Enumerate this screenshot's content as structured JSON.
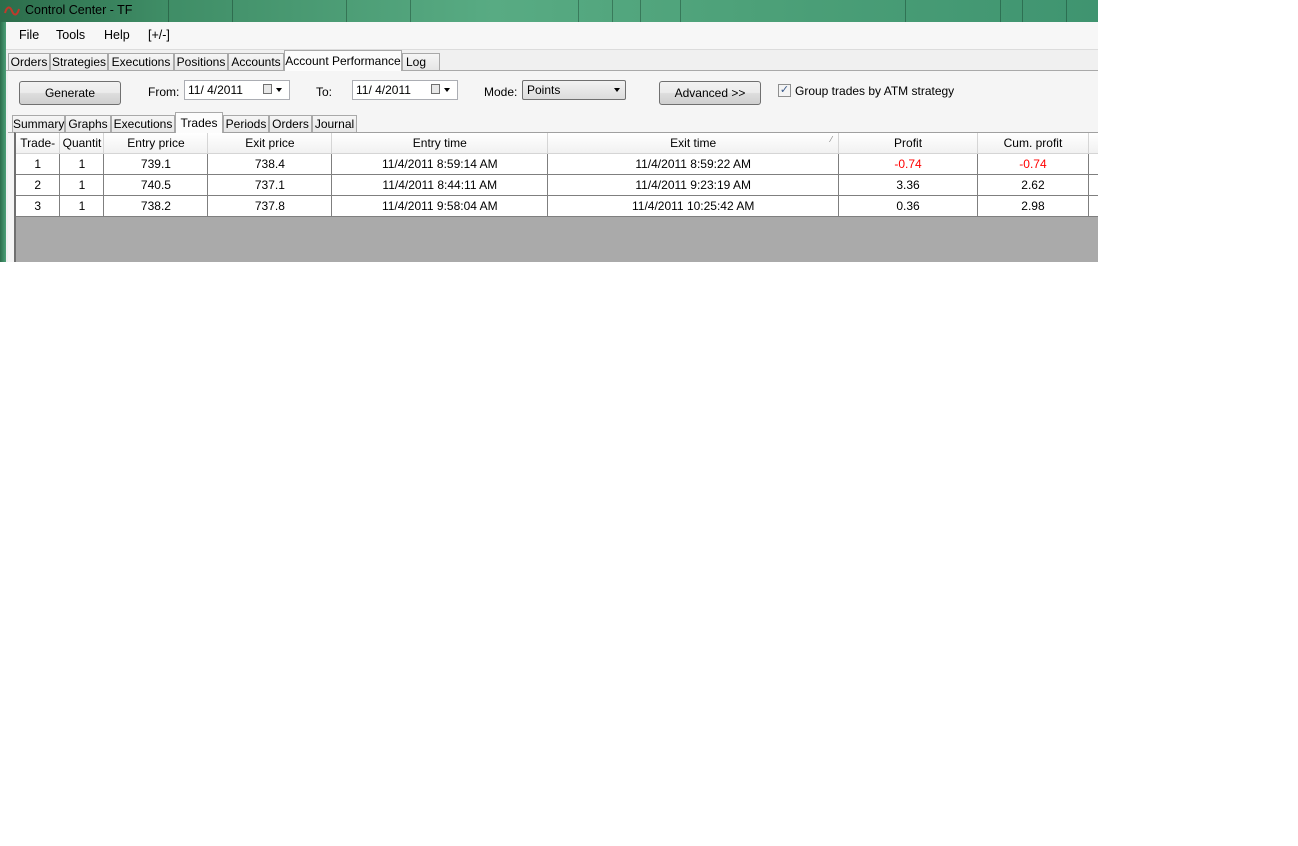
{
  "window": {
    "title": "Control Center - TF"
  },
  "menu": {
    "items": [
      "File",
      "Tools",
      "Help",
      "[+/-]"
    ]
  },
  "main_tabs": [
    "Orders",
    "Strategies",
    "Executions",
    "Positions",
    "Accounts",
    "Account Performance",
    "Log"
  ],
  "main_tab_active": "Account Performance",
  "toolbar": {
    "generate_label": "Generate",
    "from_label": "From:",
    "from_value": "11/ 4/2011",
    "to_label": "To:",
    "to_value": "11/ 4/2011",
    "mode_label": "Mode:",
    "mode_value": "Points",
    "advanced_label": "Advanced >>",
    "group_checkbox_label": "Group trades by ATM strategy",
    "group_checkbox_checked": true
  },
  "sub_tabs": [
    "Summary",
    "Graphs",
    "Executions",
    "Trades",
    "Periods",
    "Orders",
    "Journal"
  ],
  "sub_tab_active": "Trades",
  "trades_table": {
    "columns": [
      "Trade-",
      "Quantit",
      "Entry price",
      "Exit price",
      "Entry time",
      "Exit time",
      "Profit",
      "Cum. profit"
    ],
    "rows": [
      [
        "1",
        "1",
        "739.1",
        "738.4",
        "11/4/2011 8:59:14 AM",
        "11/4/2011 8:59:22 AM",
        "-0.74",
        "-0.74"
      ],
      [
        "2",
        "1",
        "740.5",
        "737.1",
        "11/4/2011 8:44:11 AM",
        "11/4/2011 9:23:19 AM",
        "3.36",
        "2.62"
      ],
      [
        "3",
        "1",
        "738.2",
        "737.8",
        "11/4/2011 9:58:04 AM",
        "11/4/2011 10:25:42 AM",
        "0.36",
        "2.98"
      ]
    ],
    "negative_color": "#ff0000"
  }
}
